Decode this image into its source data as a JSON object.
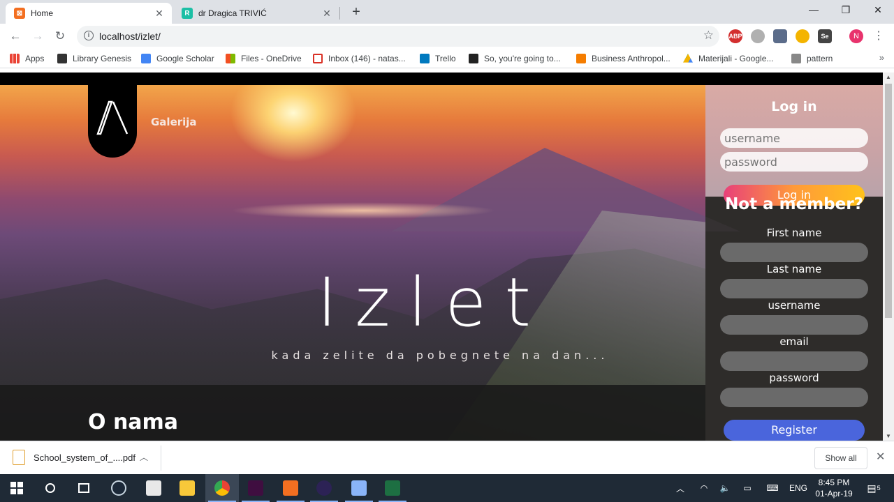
{
  "browser": {
    "tabs": [
      {
        "title": "Home",
        "favicon_color": "#f36f21",
        "active": true
      },
      {
        "title": "dr Dragica TRIVIĆ",
        "favicon_color": "#1cbfa5",
        "active": false
      }
    ],
    "url": "localhost/izlet/",
    "profile_initial": "N",
    "bookmarks": [
      {
        "label": "Apps",
        "icon_color": "#ea4335"
      },
      {
        "label": "Library Genesis",
        "icon_color": "#333333"
      },
      {
        "label": "Google Scholar",
        "icon_color": "#4285f4"
      },
      {
        "label": "Files - OneDrive",
        "icon_color": "#f25022"
      },
      {
        "label": "Inbox (146) - natas...",
        "icon_color": "#d93025"
      },
      {
        "label": "Trello",
        "icon_color": "#0079bf"
      },
      {
        "label": "So, you're going to...",
        "icon_color": "#222222"
      },
      {
        "label": "Business Anthropol...",
        "icon_color": "#f57d00"
      },
      {
        "label": "Materijali - Google...",
        "icon_color": "#0f9d58"
      },
      {
        "label": "pattern",
        "icon_color": "#888888"
      }
    ]
  },
  "page": {
    "nav_link": "Galerija",
    "hero_title": "Izlet",
    "hero_subtitle": "kada zelite da pobegnete na dan...",
    "about_title": "O nama",
    "login": {
      "title": "Log in",
      "username_placeholder": "username",
      "password_placeholder": "password",
      "button": "Log in"
    },
    "register": {
      "title": "Not a member?",
      "fields": [
        "First name",
        "Last name",
        "username",
        "email",
        "password"
      ],
      "button": "Register"
    }
  },
  "downloads": {
    "file": "School_system_of_....pdf",
    "show_all": "Show all"
  },
  "taskbar": {
    "time": "8:45 PM",
    "date": "01-Apr-19",
    "language": "ENG",
    "notifications": "5"
  }
}
